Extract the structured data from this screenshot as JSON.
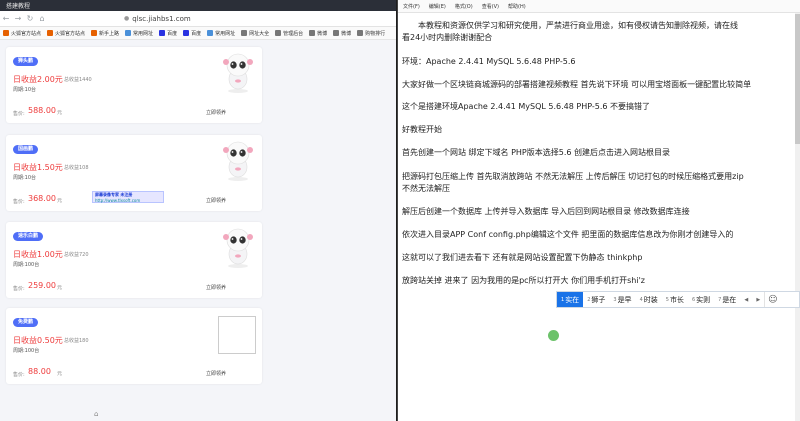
{
  "browser": {
    "tab_title": "搭建教程",
    "url": "qlsc.jiahbs1.com",
    "bookmarks": [
      {
        "label": "火狐官方站点",
        "color": "#e66000"
      },
      {
        "label": "火狐官方站点",
        "color": "#e66000"
      },
      {
        "label": "新手上路",
        "color": "#e66000"
      },
      {
        "label": "常用网址",
        "color": "#4a90d9"
      },
      {
        "label": "百度",
        "color": "#2932e1"
      },
      {
        "label": "百度",
        "color": "#2932e1"
      },
      {
        "label": "常用网址",
        "color": "#4a90d9"
      },
      {
        "label": "网址大全",
        "color": "#777777"
      },
      {
        "label": "管理后台",
        "color": "#777777"
      },
      {
        "label": "微博",
        "color": "#777777"
      },
      {
        "label": "微博",
        "color": "#777777"
      },
      {
        "label": "购物排行",
        "color": "#777777"
      }
    ],
    "cards": [
      {
        "badge": "狮头鹏",
        "badge_color": "#4f6ef7",
        "income": "日收益2.00元",
        "total": "总收益1440",
        "period": "周期:10台",
        "price_label": "售价:",
        "price": "588.00",
        "unit": "元",
        "rent": "立即领养",
        "has_robot": true
      },
      {
        "badge": "国画鹏",
        "badge_color": "#4f6ef7",
        "income": "日收益1.50元",
        "total": "总收益108",
        "period": "周期:10台",
        "price_label": "售价:",
        "price": "368.00",
        "unit": "元",
        "rent": "立即领养",
        "has_robot": true
      },
      {
        "badge": "速乐白鹏",
        "badge_color": "#4f6ef7",
        "income": "日收益1.00元",
        "total": "总收益720",
        "period": "周期:100台",
        "price_label": "售价:",
        "price": "259.00",
        "unit": "元",
        "rent": "立即领养",
        "has_robot": true
      },
      {
        "badge": "免费鹏",
        "badge_color": "#4f6ef7",
        "income": "日收益0.50元",
        "total": "总收益180",
        "period": "周期:100台",
        "price_label": "售价:",
        "price": "88.00",
        "unit": "元",
        "rent": "立即领养",
        "has_robot": false
      }
    ],
    "overlay": {
      "line1": "屏幕录像专家  未注册",
      "line2": "http://www.tlxsoft.com"
    }
  },
  "notepad": {
    "menus": [
      "文件(F)",
      "编辑(E)",
      "格式(O)",
      "查看(V)",
      "帮助(H)"
    ],
    "lines": [
      "　　本教程和资源仅供学习和研究使用，严禁进行商业用途，如有侵权请告知删除视频，请在线",
      "看24小时内删除谢谢配合",
      "环境：Apache 2.4.41  MySQL 5.6.48  PHP-5.6",
      "大家好做一个区块链商城源码的部署搭建视频教程  首先说下环境  可以用宝塔面板一键配置比较简单",
      "这个是搭建环境Apache 2.4.41  MySQL 5.6.48  PHP-5.6  不要搞错了",
      "好教程开始",
      "首先创建一个网站  绑定下域名  PHP版本选择5.6  创建后点击进入网站根目录",
      "把源码打包压缩上传  首先取消放跨站  不然无法解压  上传后解压  切记打包的时候压缩格式要用zip",
      "不然无法解压",
      "解压后创建一个数据库  上传并导入数据库  导入后回到网站根目录  修改数据库连接",
      "依次进入目录APP Conf  config.php编辑这个文件  把里面的数据库信息改为你刚才创建导入的",
      "这就可以了我们进去看下  还有就是网站设置配置下伪静态  thinkphp",
      "放跨站关掉  进来了  因为我用的是pc所以打开大  你们用手机打开shi'z"
    ],
    "ime_candidates": [
      {
        "num": "1",
        "text": "实在"
      },
      {
        "num": "2",
        "text": "狮子"
      },
      {
        "num": "3",
        "text": "是早"
      },
      {
        "num": "4",
        "text": "时装"
      },
      {
        "num": "5",
        "text": "市长"
      },
      {
        "num": "6",
        "text": "实则"
      },
      {
        "num": "7",
        "text": "是在"
      }
    ]
  }
}
